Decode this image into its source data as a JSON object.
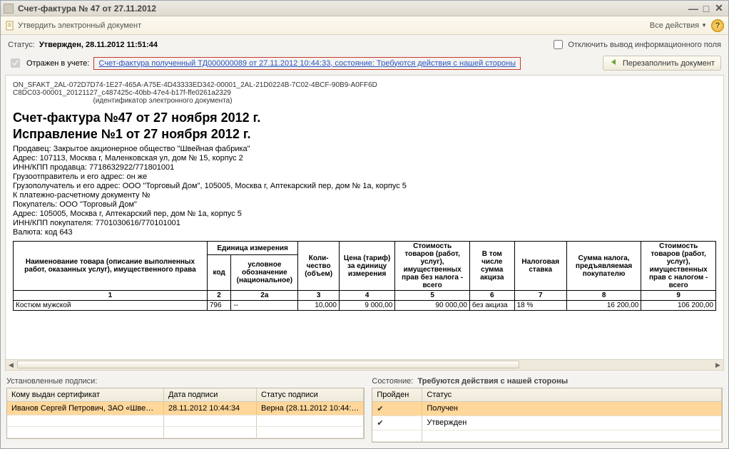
{
  "window": {
    "title": "Счет-фактура № 47 от 27.11.2012"
  },
  "toolbar": {
    "approve": "Утвердить электронный документ",
    "all_actions": "Все действия"
  },
  "status": {
    "label": "Статус:",
    "value": "Утвержден, 28.11.2012 11:51:44",
    "hide_info": "Отключить вывод информационного поля"
  },
  "reflect": {
    "label": "Отражен в учете:",
    "link": "Счет-фактура полученный ТД000000089 от 27.11.2012 10:44:33, состояние: Требуются действия с нашей стороны",
    "refill": "Перезаполнить документ"
  },
  "doc_id": {
    "line1": "ON_SFAKT_2AL-072D7D74-1E27-465A-A75E-4D43333ED342-00001_2AL-21D0224B-7C02-4BCF-90B9-A0FF6D",
    "line2": "C8DC03-00001_20121127_c487425c-40bb-47e4-b17f-ffe0261a2329",
    "caption": "(идентификатор электронного документа)"
  },
  "doc": {
    "title": "Счет-фактура №47 от 27 ноября 2012 г.",
    "subtitle": "Исправление №1 от 27 ноября 2012 г.",
    "seller": "Продавец: Закрытое акционерное общество \"Швейная фабрика\"",
    "seller_addr": "Адрес: 107113, Москва г, Маленковская ул, дом № 15, корпус 2",
    "seller_inn": "ИНН/КПП продавца: 7718632922/771801001",
    "shipper": "Грузоотправитель и его адрес: он же",
    "consignee": "Грузополучатель и его адрес: ООО \"Торговый Дом\", 105005, Москва г, Аптекарский пер, дом № 1а, корпус 5",
    "paydoc": "К платежно-расчетному документу №",
    "buyer": "Покупатель: ООО \"Торговый Дом\"",
    "buyer_addr": "Адрес: 105005, Москва г, Аптекарский пер, дом № 1а, корпус 5",
    "buyer_inn": "ИНН/КПП покупателя: 7701030616/770101001",
    "currency": "Валюта: код 643"
  },
  "table": {
    "head": {
      "name": "Наименование товара (описание выполненных работ, оказанных услуг), имущественного права",
      "unit": "Единица измерения",
      "unit_code": "код",
      "unit_name": "условное обозначение (национальное)",
      "qty": "Коли-чество (объем)",
      "price": "Цена (тариф) за единицу измерения",
      "cost_notax": "Стоимость товаров (работ, услуг), имущественных прав без налога - всего",
      "excise": "В том числе сумма акциза",
      "taxrate": "Налоговая ставка",
      "taxsum": "Сумма налога, предъявляемая покупателю",
      "cost_tax": "Стоимость товаров (работ, услуг), имущественных прав с налогом - всего",
      "n1": "1",
      "n2": "2",
      "n2a": "2а",
      "n3": "3",
      "n4": "4",
      "n5": "5",
      "n6": "6",
      "n7": "7",
      "n8": "8",
      "n9": "9"
    },
    "rows": [
      {
        "name": "Костюм мужской",
        "code": "796",
        "unit": "--",
        "qty": "10,000",
        "price": "9 000,00",
        "cost_notax": "90 000,00",
        "excise": "без акциза",
        "taxrate": "18 %",
        "taxsum": "16 200,00",
        "cost_tax": "106 200,00"
      }
    ]
  },
  "signatures": {
    "title": "Установленные подписи:",
    "head": {
      "owner": "Кому выдан сертификат",
      "date": "Дата подписи",
      "status": "Статус подписи"
    },
    "rows": [
      {
        "owner": "Иванов Сергей Петрович, ЗАО «Шве…",
        "date": "28.11.2012 10:44:34",
        "status": "Верна (28.11.2012 10:44:…"
      }
    ]
  },
  "state": {
    "title_label": "Состояние:",
    "title_value": "Требуются действия с нашей стороны",
    "head": {
      "passed": "Пройден",
      "status": "Статус"
    },
    "rows": [
      {
        "passed": "✔",
        "status": "Получен"
      },
      {
        "passed": "✔",
        "status": "Утвержден"
      }
    ]
  }
}
